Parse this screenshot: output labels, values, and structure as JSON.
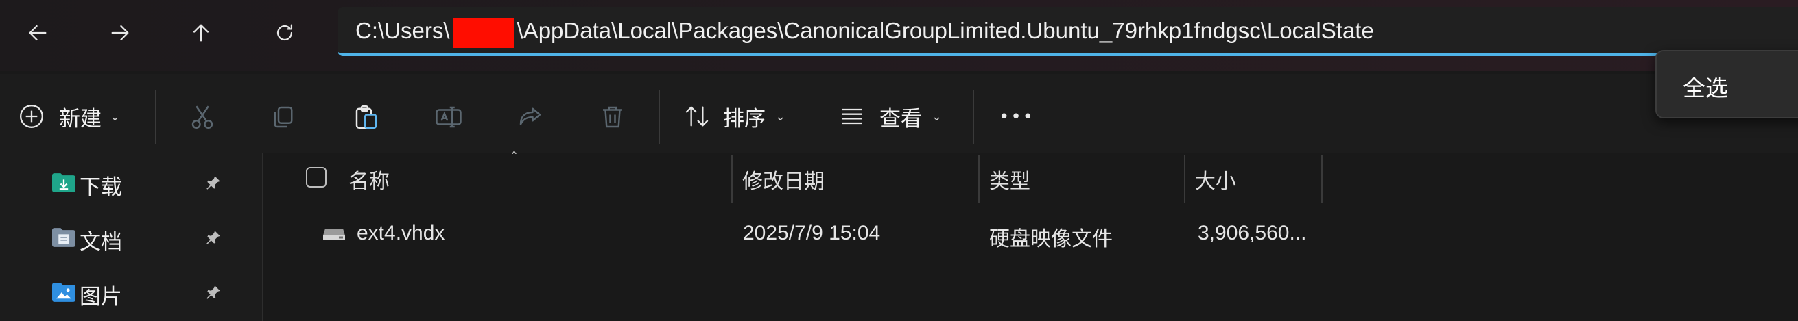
{
  "address_bar": {
    "path_prefix": "C:\\Users\\",
    "path_rest": "\\AppData\\Local\\Packages\\CanonicalGroupLimited.Ubuntu_79rhkp1fndgsc\\LocalState",
    "accent_color": "#4fb3e8",
    "redaction_color": "#ff0d00"
  },
  "nav_buttons": [
    "back-arrow-icon",
    "forward-arrow-icon",
    "up-arrow-icon",
    "refresh-icon"
  ],
  "toolbar": {
    "new_label": "新建",
    "sort_label": "排序",
    "view_label": "查看",
    "more_label": "•••",
    "action_icons": [
      "cut-icon",
      "copy-icon",
      "paste-icon",
      "rename-icon",
      "share-icon",
      "delete-icon"
    ]
  },
  "popup": {
    "select_all_label": "全选"
  },
  "sidebar": {
    "items": [
      {
        "label": "下载",
        "icon": "downloads-folder-icon",
        "pinned": true
      },
      {
        "label": "文档",
        "icon": "documents-folder-icon",
        "pinned": true
      },
      {
        "label": "图片",
        "icon": "pictures-folder-icon",
        "pinned": true
      }
    ]
  },
  "columns": {
    "name": "名称",
    "date": "修改日期",
    "type": "类型",
    "size": "大小"
  },
  "files": [
    {
      "name": "ext4.vhdx",
      "date": "2025/7/9 15:04",
      "type": "硬盘映像文件",
      "size": "3,906,560...",
      "icon": "disk-image-icon"
    }
  ]
}
